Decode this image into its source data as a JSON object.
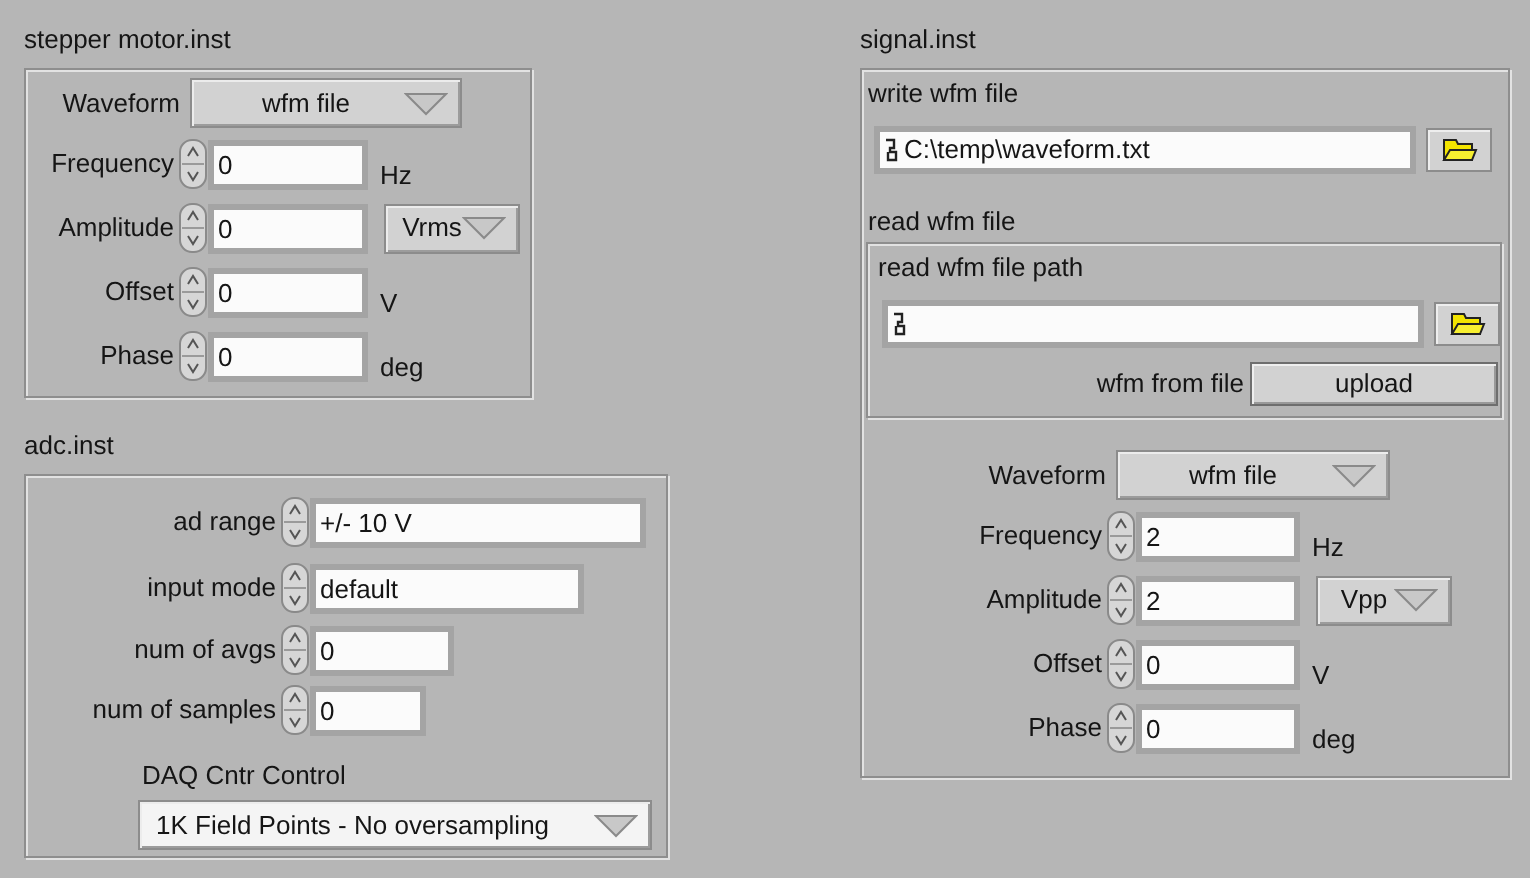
{
  "stepper_motor": {
    "title": "stepper motor.inst",
    "waveform": {
      "label": "Waveform",
      "value": "wfm file"
    },
    "numerics": [
      {
        "label": "Frequency",
        "value": "0",
        "unit": {
          "kind": "text",
          "text": "Hz"
        }
      },
      {
        "label": "Amplitude",
        "value": "0",
        "unit": {
          "kind": "ring",
          "text": "Vrms"
        }
      },
      {
        "label": "Offset",
        "value": "0",
        "unit": {
          "kind": "text",
          "text": "V"
        }
      },
      {
        "label": "Phase",
        "value": "0",
        "unit": {
          "kind": "text",
          "text": "deg"
        }
      }
    ]
  },
  "adc": {
    "title": "adc.inst",
    "controls": [
      {
        "label": "ad range",
        "value": "+/- 10 V"
      },
      {
        "label": "input mode",
        "value": "default"
      },
      {
        "label": "num of avgs",
        "value": "0"
      },
      {
        "label": "num of samples",
        "value": "0"
      }
    ],
    "daq": {
      "label": "DAQ Cntr Control",
      "value": "1K Field Points - No oversampling"
    }
  },
  "signal": {
    "title": "signal.inst",
    "write_file": {
      "label": "write wfm file",
      "path": "C:\\temp\\waveform.txt"
    },
    "read_file": {
      "title": "read wfm file",
      "path_label": "read wfm file path",
      "button_label": "wfm from file",
      "button": "upload"
    },
    "waveform": {
      "label": "Waveform",
      "value": "wfm file"
    },
    "numerics": [
      {
        "label": "Frequency",
        "value": "2",
        "unit": {
          "kind": "text",
          "text": "Hz"
        }
      },
      {
        "label": "Amplitude",
        "value": "2",
        "unit": {
          "kind": "ring",
          "text": "Vpp"
        }
      },
      {
        "label": "Offset",
        "value": "0",
        "unit": {
          "kind": "text",
          "text": "V"
        }
      },
      {
        "label": "Phase",
        "value": "0",
        "unit": {
          "kind": "text",
          "text": "deg"
        }
      }
    ]
  }
}
